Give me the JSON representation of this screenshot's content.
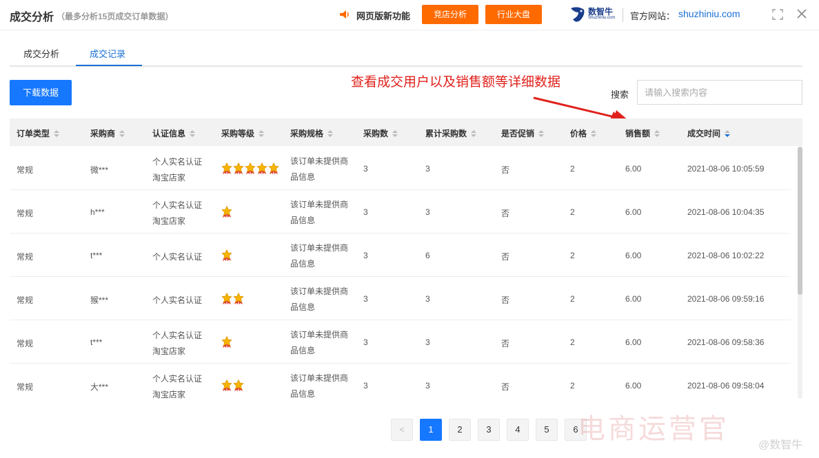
{
  "header": {
    "title": "成交分析",
    "subtitle": "（最多分析15页成交订单数据）",
    "new_feature": "网页版新功能",
    "btn_competitor": "竞店分析",
    "btn_industry": "行业大盘",
    "logo_text": "数智牛",
    "logo_sub": "Shuzhiniu.com",
    "site_label": "官方网站：",
    "site_url": "shuzhiniu.com",
    "accent": "#ff6a00"
  },
  "tabs": [
    {
      "label": "成交分析",
      "active": false
    },
    {
      "label": "成交记录",
      "active": true
    }
  ],
  "toolbar": {
    "download_label": "下载数据",
    "annotation": "查看成交用户以及销售额等详细数据",
    "search_label": "搜索",
    "search_placeholder": "请输入搜索内容"
  },
  "table": {
    "columns": [
      "订单类型",
      "采购商",
      "认证信息",
      "采购等级",
      "采购规格",
      "采购数",
      "累计采购数",
      "是否促销",
      "价格",
      "销售额",
      "成交时间"
    ],
    "sorted_column": "成交时间",
    "rows": [
      {
        "type": "常规",
        "buyer": "微***",
        "cert": [
          "个人实名认证",
          "淘宝店家"
        ],
        "stars": 5,
        "spec": "该订单未提供商品信息",
        "qty": "3",
        "total_qty": "3",
        "promo": "否",
        "price": "2",
        "sales": "6.00",
        "time": "2021-08-06 10:05:59"
      },
      {
        "type": "常规",
        "buyer": "h***",
        "cert": [
          "个人实名认证",
          "淘宝店家"
        ],
        "stars": 1,
        "spec": "该订单未提供商品信息",
        "qty": "3",
        "total_qty": "3",
        "promo": "否",
        "price": "2",
        "sales": "6.00",
        "time": "2021-08-06 10:04:35"
      },
      {
        "type": "常规",
        "buyer": "t***",
        "cert": [
          "个人实名认证"
        ],
        "stars": 1,
        "spec": "该订单未提供商品信息",
        "qty": "3",
        "total_qty": "6",
        "promo": "否",
        "price": "2",
        "sales": "6.00",
        "time": "2021-08-06 10:02:22"
      },
      {
        "type": "常规",
        "buyer": "猴***",
        "cert": [
          "个人实名认证"
        ],
        "stars": 2,
        "spec": "该订单未提供商品信息",
        "qty": "3",
        "total_qty": "3",
        "promo": "否",
        "price": "2",
        "sales": "6.00",
        "time": "2021-08-06 09:59:16"
      },
      {
        "type": "常规",
        "buyer": "t***",
        "cert": [
          "个人实名认证",
          "淘宝店家"
        ],
        "stars": 1,
        "spec": "该订单未提供商品信息",
        "qty": "3",
        "total_qty": "3",
        "promo": "否",
        "price": "2",
        "sales": "6.00",
        "time": "2021-08-06 09:58:36"
      },
      {
        "type": "常规",
        "buyer": "大***",
        "cert": [
          "个人实名认证",
          "淘宝店家"
        ],
        "stars": 2,
        "spec": "该订单未提供商品信息",
        "qty": "3",
        "total_qty": "3",
        "promo": "否",
        "price": "2",
        "sales": "6.00",
        "time": "2021-08-06 09:58:04"
      }
    ]
  },
  "pagination": {
    "prev": "<",
    "pages": [
      "1",
      "2",
      "3",
      "4",
      "5",
      "6"
    ],
    "current": "1"
  },
  "watermark": {
    "text": "电商运营官",
    "sub": "@数智牛"
  }
}
